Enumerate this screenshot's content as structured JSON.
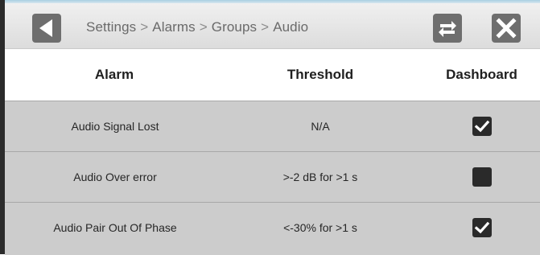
{
  "header": {
    "breadcrumb": [
      "Settings",
      "Alarms",
      "Groups",
      "Audio"
    ],
    "separator": ">",
    "back_icon": "back-arrow-icon",
    "swap_icon": "swap-icon",
    "close_icon": "close-icon"
  },
  "table": {
    "columns": {
      "alarm": "Alarm",
      "threshold": "Threshold",
      "dashboard": "Dashboard"
    },
    "rows": [
      {
        "alarm": "Audio Signal Lost",
        "threshold": "N/A",
        "dashboard": true
      },
      {
        "alarm": "Audio Over error",
        "threshold": ">-2 dB for >1 s",
        "dashboard": false
      },
      {
        "alarm": "Audio Pair Out Of Phase",
        "threshold": "<-30% for >1 s",
        "dashboard": true
      }
    ]
  },
  "colors": {
    "row_background": "#cccccc",
    "header_background": "#e4e4e4",
    "icon_fill": "#6e6e6e",
    "checkbox_fill": "#2a2a2a",
    "accent_top": "#a9cfe3"
  }
}
